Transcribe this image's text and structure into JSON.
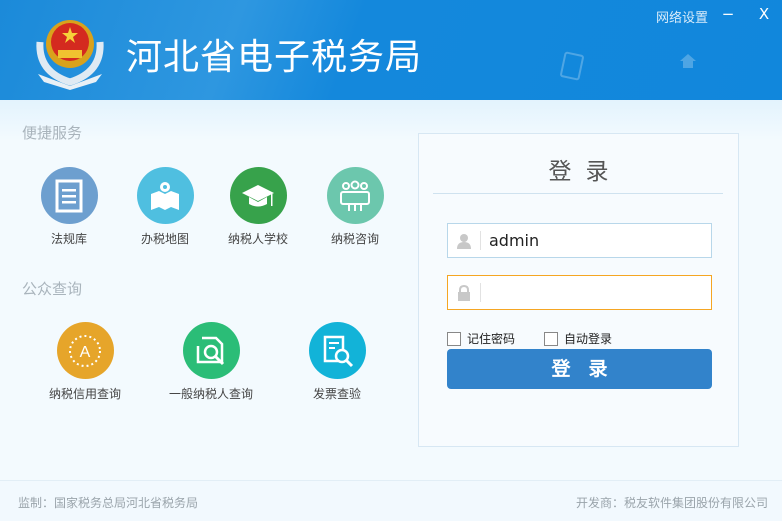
{
  "header": {
    "title": "河北省电子税务局",
    "network_settings": "网络设置",
    "minimize": "−",
    "close": "X"
  },
  "quick_services": {
    "heading": "便捷服务",
    "items": [
      {
        "label": "法规库",
        "icon": "regulations-book-icon",
        "color": "#6d9fcf"
      },
      {
        "label": "办税地图",
        "icon": "map-pin-icon",
        "color": "#4fbfe0"
      },
      {
        "label": "纳税人学校",
        "icon": "graduation-cap-icon",
        "color": "#37a24b"
      },
      {
        "label": "纳税咨询",
        "icon": "people-group-icon",
        "color": "#6cc7ad"
      }
    ]
  },
  "public_query": {
    "heading": "公众查询",
    "items": [
      {
        "label": "纳税信用查询",
        "icon": "credit-laurel-icon",
        "color": "#e6a52a"
      },
      {
        "label": "一般纳税人查询",
        "icon": "document-search-icon",
        "color": "#2bbd77"
      },
      {
        "label": "发票查验",
        "icon": "invoice-search-icon",
        "color": "#12b3d8"
      }
    ]
  },
  "login": {
    "title": "登录",
    "username": "admin",
    "password": "",
    "remember": "记住密码",
    "auto_login": "自动登录",
    "submit": "登录",
    "username_border": "#b8d7ea",
    "password_border": "#f5a623"
  },
  "footer": {
    "supervisor": "监制：国家税务总局河北省税务局",
    "developer": "开发商：税友软件集团股份有限公司"
  }
}
